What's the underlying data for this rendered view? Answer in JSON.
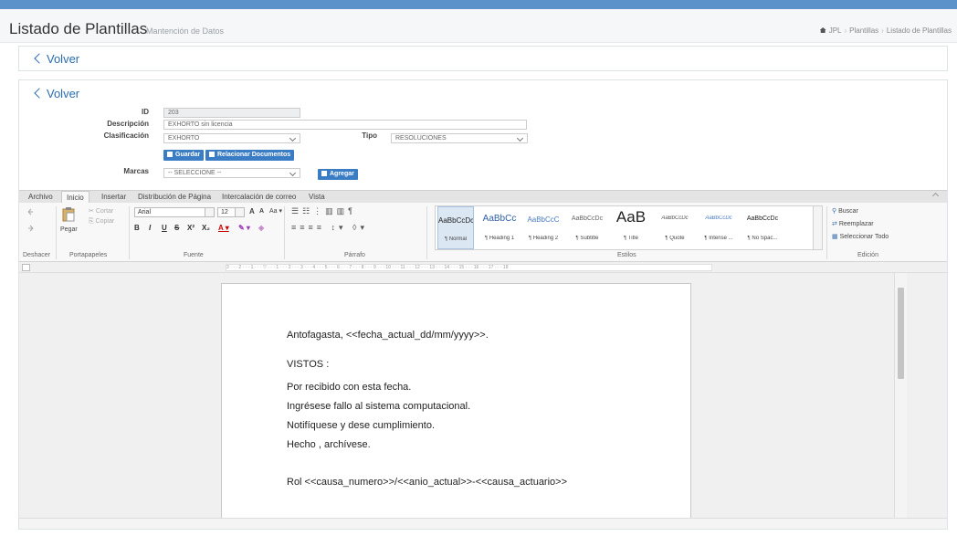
{
  "header": {
    "title": "Listado de Plantillas",
    "subtitle": "Mantención de Datos",
    "breadcrumb": [
      "JPL",
      "Plantillas",
      "Listado de Plantillas"
    ]
  },
  "back_label": "Volver",
  "form": {
    "id_label": "ID",
    "id_value": "203",
    "descripcion_label": "Descripción",
    "descripcion_value": "EXHORTO sin licencia",
    "clasificacion_label": "Clasificación",
    "clasificacion_value": "EXHORTO",
    "tipo_label": "Tipo",
    "tipo_value": "RESOLUCIONES",
    "guardar_label": "Guardar",
    "relacionar_label": "Relacionar Documentos",
    "marcas_label": "Marcas",
    "marcas_value": "-- SELECCIONE --",
    "agregar_label": "Agregar"
  },
  "ribbon": {
    "tabs": [
      "Archivo",
      "Inicio",
      "Insertar",
      "Distribución de Página",
      "Intercalación de correo",
      "Vista"
    ],
    "active_tab": "Inicio",
    "groups": [
      "Deshacer",
      "Portapapeles",
      "Fuente",
      "Párrafo",
      "Estilos",
      "Edición"
    ],
    "clipboard": {
      "paste": "Pegar",
      "cut": "Cortar",
      "copy": "Copiar"
    },
    "font": {
      "name": "Arial",
      "size": "12"
    },
    "styles": [
      {
        "preview": "AaBbCcDc",
        "name": "¶ Normal"
      },
      {
        "preview": "AaBbCc",
        "name": "¶ Heading 1"
      },
      {
        "preview": "AaBbCcC",
        "name": "¶ Heading 2"
      },
      {
        "preview": "AaBbCcDc",
        "name": "¶ Subtitle"
      },
      {
        "preview": "AaB",
        "name": "¶ Title"
      },
      {
        "preview": "AaBbCcDc",
        "name": "¶ Quote"
      },
      {
        "preview": "AaBbCcDc",
        "name": "¶ Intense ..."
      },
      {
        "preview": "AaBbCcDc",
        "name": "¶ No Spac..."
      }
    ],
    "editing": {
      "find": "Buscar",
      "replace": "Reemplazar",
      "select_all": "Seleccionar Todo"
    }
  },
  "ruler_text": "3 · · · 2 · · · 1 · · · ▽ · · · 1 · · · 2 · · · 3 · · · 4 · · · 5 · · · 6 · · · 7 · · · 8 · · · 9 · · · 10 · · · 11 · · · 12 · · · 13 · · · 14 · · · 15 · · · 16 · · · 17 · · · 18",
  "document": {
    "lines": [
      "Antofagasta, <<fecha_actual_dd/mm/yyyy>>.",
      "VISTOS :",
      "Por recibido con esta fecha.",
      "Ingrésese fallo al sistema computacional.",
      "Notifíquese y dese cumplimiento.",
      "Hecho , archívese.",
      "Rol <<causa_numero>>/<<anio_actual>>-<<causa_actuario>>"
    ]
  }
}
